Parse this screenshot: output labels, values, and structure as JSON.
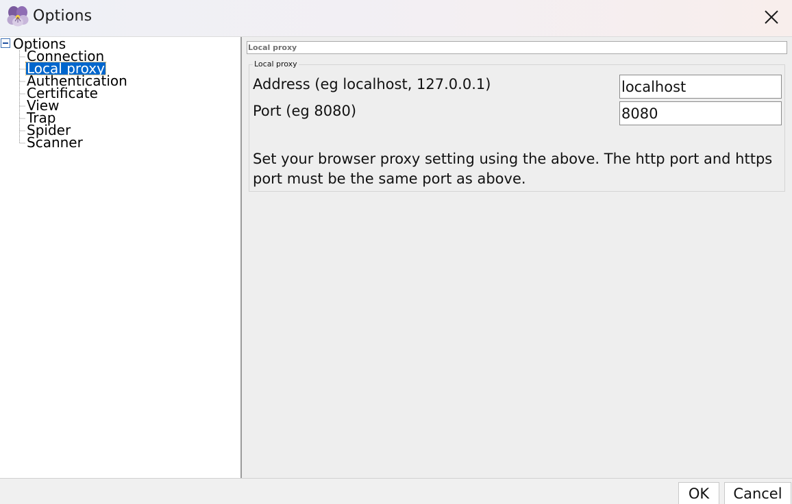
{
  "window": {
    "title": "Options",
    "close_icon": "close-icon",
    "app_icon": "pansy-flower-icon"
  },
  "tree": {
    "root_label": "Options",
    "expander_icon": "collapse-minus-icon",
    "items": [
      {
        "label": "Connection"
      },
      {
        "label": "Local proxy",
        "selected": true
      },
      {
        "label": "Authentication"
      },
      {
        "label": "Certificate"
      },
      {
        "label": "View"
      },
      {
        "label": "Trap"
      },
      {
        "label": "Spider"
      },
      {
        "label": "Scanner"
      }
    ],
    "selection_color": "#0066cc"
  },
  "panel": {
    "header": "Local proxy",
    "group_title": "Local proxy",
    "address_label": "Address (eg localhost, 127.0.0.1)",
    "address_value": "localhost",
    "port_label": "Port (eg 8080)",
    "port_value": "8080",
    "help_text": "Set your browser proxy setting using the above. The http port and https port must be the same port as above."
  },
  "buttons": {
    "ok": "OK",
    "cancel": "Cancel"
  }
}
